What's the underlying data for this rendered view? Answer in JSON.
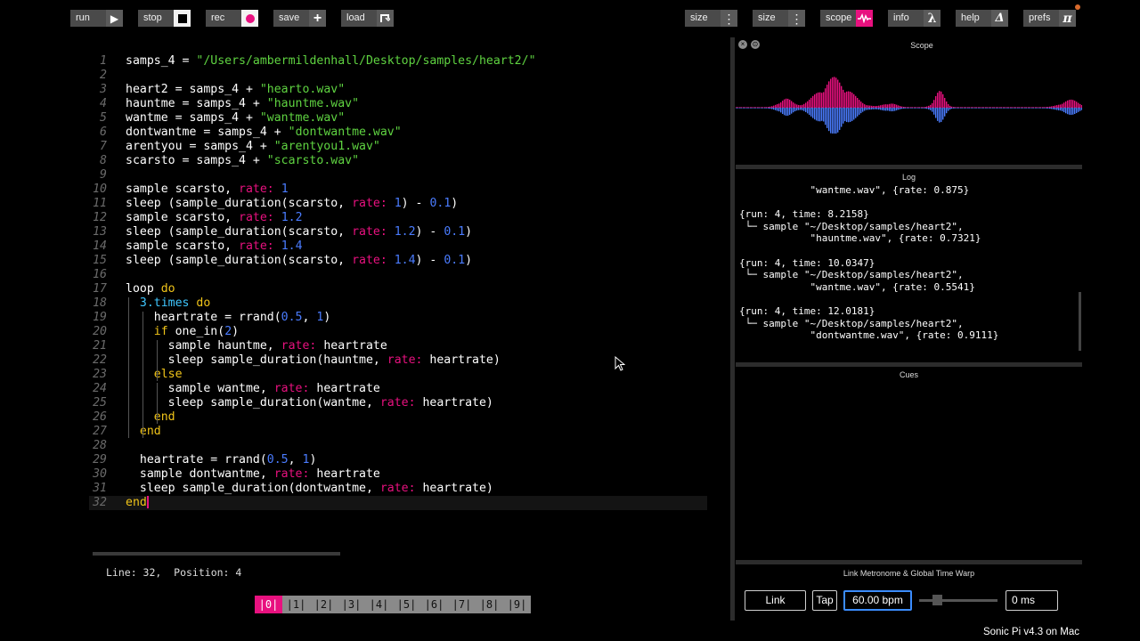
{
  "toolbar": {
    "run": "run",
    "stop": "stop",
    "rec": "rec",
    "save": "save",
    "load": "load",
    "size1": "size",
    "size2": "size",
    "scope": "scope",
    "info": "info",
    "help": "help",
    "prefs": "prefs",
    "icons": {
      "run": "play-icon",
      "stop": "stop-square-icon",
      "rec": "record-dot-icon",
      "save": "plus-icon",
      "load": "load-arrow-icon",
      "size1": "vertical-dots-icon",
      "size2": "vertical-dots-icon",
      "scope": "waveform-icon",
      "info": "lambda-icon",
      "help": "delta-icon",
      "prefs": "pi-icon"
    }
  },
  "editor": {
    "lines": [
      {
        "n": "1",
        "tokens": [
          [
            "samps_4 = ",
            ""
          ],
          [
            "\"/Users/ambermildenhall/Desktop/samples/heart2/\"",
            "str"
          ]
        ]
      },
      {
        "n": "2",
        "tokens": []
      },
      {
        "n": "3",
        "tokens": [
          [
            "heart2 = samps_4 + ",
            ""
          ],
          [
            "\"hearto.wav\"",
            "str"
          ]
        ]
      },
      {
        "n": "4",
        "tokens": [
          [
            "hauntme = samps_4 + ",
            ""
          ],
          [
            "\"hauntme.wav\"",
            "str"
          ]
        ]
      },
      {
        "n": "5",
        "tokens": [
          [
            "wantme = samps_4 + ",
            ""
          ],
          [
            "\"wantme.wav\"",
            "str"
          ]
        ]
      },
      {
        "n": "6",
        "tokens": [
          [
            "dontwantme = samps_4 + ",
            ""
          ],
          [
            "\"dontwantme.wav\"",
            "str"
          ]
        ]
      },
      {
        "n": "7",
        "tokens": [
          [
            "arentyou = samps_4 + ",
            ""
          ],
          [
            "\"arentyou1.wav\"",
            "str"
          ]
        ]
      },
      {
        "n": "8",
        "tokens": [
          [
            "scarsto = samps_4 + ",
            ""
          ],
          [
            "\"scarsto.wav\"",
            "str"
          ]
        ]
      },
      {
        "n": "9",
        "tokens": []
      },
      {
        "n": "10",
        "tokens": [
          [
            "sample scarsto, ",
            ""
          ],
          [
            "rate: ",
            "kw"
          ],
          [
            "1",
            "num"
          ]
        ]
      },
      {
        "n": "11",
        "tokens": [
          [
            "sleep (sample_duration(scarsto, ",
            ""
          ],
          [
            "rate: ",
            "kw"
          ],
          [
            "1",
            "num"
          ],
          [
            ") - ",
            ""
          ],
          [
            "0.1",
            "num"
          ],
          [
            ")",
            ""
          ]
        ]
      },
      {
        "n": "12",
        "tokens": [
          [
            "sample scarsto, ",
            ""
          ],
          [
            "rate: ",
            "kw"
          ],
          [
            "1.2",
            "num"
          ]
        ]
      },
      {
        "n": "13",
        "tokens": [
          [
            "sleep (sample_duration(scarsto, ",
            ""
          ],
          [
            "rate: ",
            "kw"
          ],
          [
            "1.2",
            "num"
          ],
          [
            ") - ",
            ""
          ],
          [
            "0.1",
            "num"
          ],
          [
            ")",
            ""
          ]
        ]
      },
      {
        "n": "14",
        "tokens": [
          [
            "sample scarsto, ",
            ""
          ],
          [
            "rate: ",
            "kw"
          ],
          [
            "1.4",
            "num"
          ]
        ]
      },
      {
        "n": "15",
        "tokens": [
          [
            "sleep (sample_duration(scarsto, ",
            ""
          ],
          [
            "rate: ",
            "kw"
          ],
          [
            "1.4",
            "num"
          ],
          [
            ") - ",
            ""
          ],
          [
            "0.1",
            "num"
          ],
          [
            ")",
            ""
          ]
        ]
      },
      {
        "n": "16",
        "tokens": []
      },
      {
        "n": "17",
        "tokens": [
          [
            "loop ",
            ""
          ],
          [
            "do",
            "do"
          ]
        ]
      },
      {
        "n": "18",
        "tokens": [
          [
            "  ",
            ""
          ],
          [
            "3.times",
            "cy"
          ],
          [
            " ",
            ""
          ],
          [
            "do",
            "do"
          ]
        ]
      },
      {
        "n": "19",
        "tokens": [
          [
            "    heartrate = rrand(",
            ""
          ],
          [
            "0.5",
            "num"
          ],
          [
            ", ",
            ""
          ],
          [
            "1",
            "num"
          ],
          [
            ")",
            ""
          ]
        ]
      },
      {
        "n": "20",
        "tokens": [
          [
            "    ",
            ""
          ],
          [
            "if",
            "do"
          ],
          [
            " one_in(",
            ""
          ],
          [
            "2",
            "num"
          ],
          [
            ")",
            ""
          ]
        ]
      },
      {
        "n": "21",
        "tokens": [
          [
            "      sample hauntme, ",
            ""
          ],
          [
            "rate: ",
            "kw"
          ],
          [
            "heartrate",
            ""
          ]
        ]
      },
      {
        "n": "22",
        "tokens": [
          [
            "      sleep sample_duration(hauntme, ",
            ""
          ],
          [
            "rate: ",
            "kw"
          ],
          [
            "heartrate)",
            ""
          ]
        ]
      },
      {
        "n": "23",
        "tokens": [
          [
            "    ",
            ""
          ],
          [
            "else",
            "do"
          ]
        ]
      },
      {
        "n": "24",
        "tokens": [
          [
            "      sample wantme, ",
            ""
          ],
          [
            "rate: ",
            "kw"
          ],
          [
            "heartrate",
            ""
          ]
        ]
      },
      {
        "n": "25",
        "tokens": [
          [
            "      sleep sample_duration(wantme, ",
            ""
          ],
          [
            "rate: ",
            "kw"
          ],
          [
            "heartrate)",
            ""
          ]
        ]
      },
      {
        "n": "26",
        "tokens": [
          [
            "    ",
            ""
          ],
          [
            "end",
            "do"
          ]
        ]
      },
      {
        "n": "27",
        "tokens": [
          [
            "  ",
            ""
          ],
          [
            "end",
            "do"
          ]
        ]
      },
      {
        "n": "28",
        "tokens": []
      },
      {
        "n": "29",
        "tokens": [
          [
            "  heartrate = rrand(",
            ""
          ],
          [
            "0.5",
            "num"
          ],
          [
            ", ",
            ""
          ],
          [
            "1",
            "num"
          ],
          [
            ")",
            ""
          ]
        ]
      },
      {
        "n": "30",
        "tokens": [
          [
            "  sample dontwantme, ",
            ""
          ],
          [
            "rate: ",
            "kw"
          ],
          [
            "heartrate",
            ""
          ]
        ]
      },
      {
        "n": "31",
        "tokens": [
          [
            "  sleep sample_duration(dontwantme, ",
            ""
          ],
          [
            "rate: ",
            "kw"
          ],
          [
            "heartrate)",
            ""
          ]
        ]
      },
      {
        "n": "32",
        "tokens": [
          [
            "end",
            "do"
          ]
        ]
      }
    ],
    "status": "Line: 32,  Position: 4"
  },
  "buffers": [
    "|0|",
    "|1|",
    "|2|",
    "|3|",
    "|4|",
    "|5|",
    "|6|",
    "|7|",
    "|8|",
    "|9|"
  ],
  "active_buffer": 0,
  "scope": {
    "title": "Scope"
  },
  "log": {
    "title": "Log",
    "lines": [
      "            \"wantme.wav\", {rate: 0.875}",
      "",
      "{run: 4, time: 8.2158}",
      " └─ sample \"~/Desktop/samples/heart2\",",
      "            \"hauntme.wav\", {rate: 0.7321}",
      "",
      "{run: 4, time: 10.0347}",
      " └─ sample \"~/Desktop/samples/heart2\",",
      "            \"wantme.wav\", {rate: 0.5541}",
      "",
      "{run: 4, time: 12.0181}",
      " └─ sample \"~/Desktop/samples/heart2\",",
      "            \"dontwantme.wav\", {rate: 0.9111}"
    ]
  },
  "cues": {
    "title": "Cues"
  },
  "metronome": {
    "title": "Link Metronome & Global Time Warp",
    "link": "Link",
    "tap": "Tap",
    "bpm": "60.00 bpm",
    "warp": "0 ms"
  },
  "footer": "Sonic Pi v4.3 on Mac",
  "colors": {
    "accent": "#e8117f",
    "string": "#5fd341",
    "number": "#4a7cff",
    "keyword": "#f0c419",
    "scope_pos": "#e8117f",
    "scope_neg": "#4a7cff"
  }
}
